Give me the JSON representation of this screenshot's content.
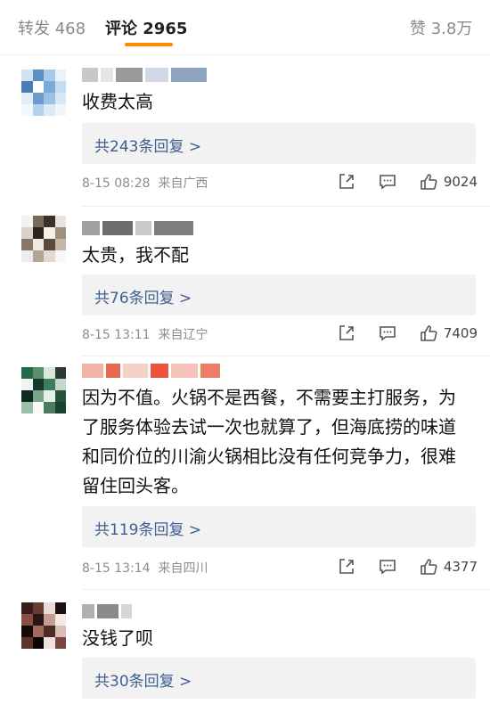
{
  "tabs": {
    "repost": "转发 468",
    "comments": "评论 2965",
    "likes": "赞 3.8万",
    "accent": "#ff8a00"
  },
  "comments": [
    {
      "text": "收费太高",
      "replies": "共243条回复 >",
      "time": "8-15 08:28",
      "location": "来自广西",
      "likes": "9024"
    },
    {
      "text": "太贵，我不配",
      "replies": "共76条回复 >",
      "time": "8-15 13:11",
      "location": "来自辽宁",
      "likes": "7409"
    },
    {
      "text": "因为不值。火锅不是西餐，不需要主打服务，为了服务体验去试一次也就算了，但海底捞的味道和同价位的川渝火锅相比没有任何竞争力，很难留住回头客。",
      "replies": "共119条回复 >",
      "time": "8-15 13:14",
      "location": "来自四川",
      "likes": "4377"
    },
    {
      "text": "没钱了呗",
      "replies": "共30条回复 >"
    }
  ],
  "icons": {
    "share": "share-icon",
    "comment": "comment-icon",
    "like": "thumbs-up-icon"
  },
  "colors": {
    "reply_link": "#3d5f8f",
    "meta": "#8c8c8c"
  }
}
